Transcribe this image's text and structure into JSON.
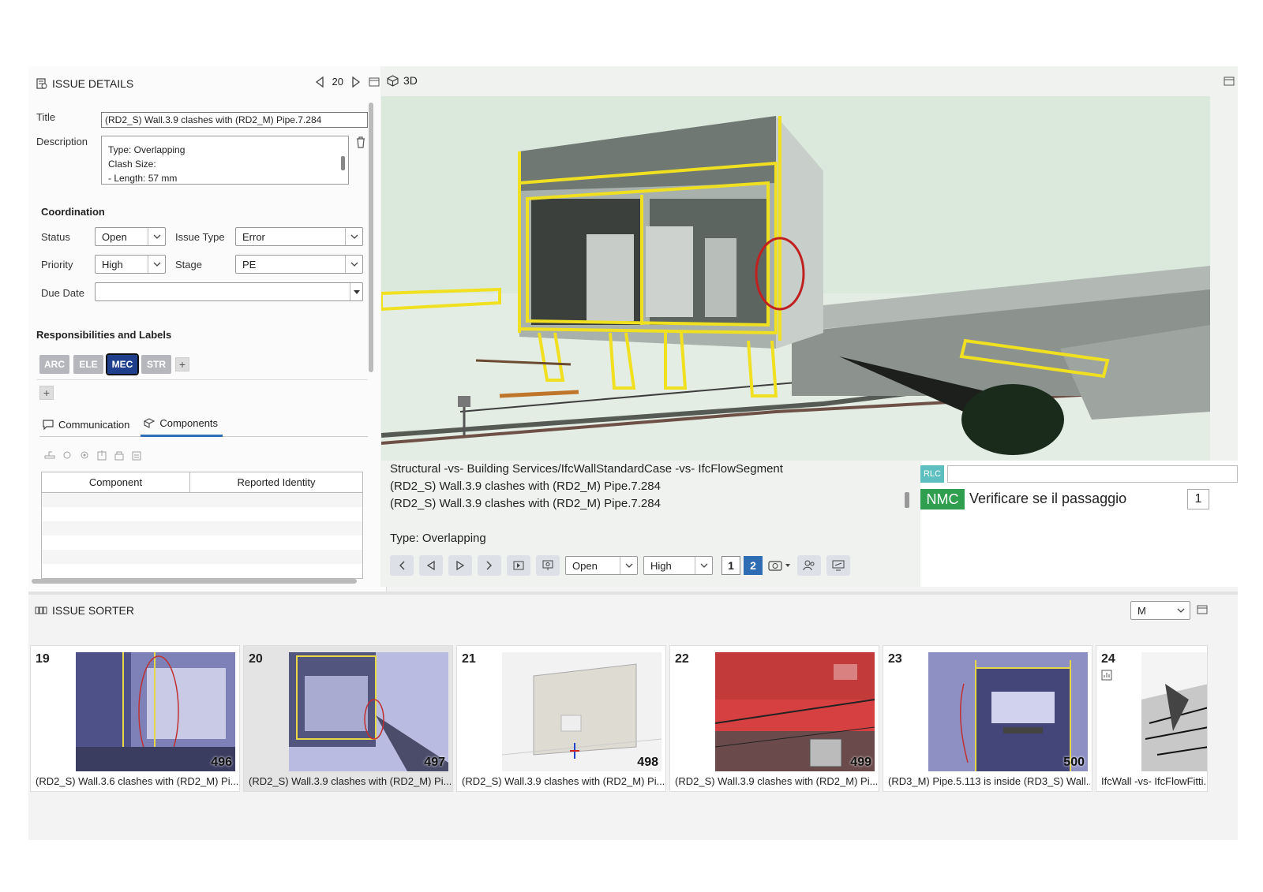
{
  "details": {
    "header": "ISSUE DETAILS",
    "issue_number": "20",
    "title_label": "Title",
    "title_value": "(RD2_S) Wall.3.9 clashes with (RD2_M) Pipe.7.284",
    "description_label": "Description",
    "description_lines": [
      "Type: Overlapping",
      "Clash Size:",
      "- Length: 57 mm"
    ],
    "coordination_header": "Coordination",
    "status_label": "Status",
    "status_value": "Open",
    "issue_type_label": "Issue Type",
    "issue_type_value": "Error",
    "priority_label": "Priority",
    "priority_value": "High",
    "stage_label": "Stage",
    "stage_value": "PE",
    "due_date_label": "Due Date",
    "due_date_value": "",
    "resp_header": "Responsibilities and Labels",
    "tags": [
      {
        "label": "ARC",
        "color": "#b5b7bd"
      },
      {
        "label": "ELE",
        "color": "#b5b7bd"
      },
      {
        "label": "MEC",
        "color": "#1f3f8c"
      },
      {
        "label": "STR",
        "color": "#b5b7bd"
      }
    ],
    "tab_communication": "Communication",
    "tab_components": "Components",
    "col_component": "Component",
    "col_reported": "Reported Identity"
  },
  "viewer": {
    "header": "3D",
    "info_lines": [
      "Structural -vs- Building Services/IfcWallStandardCase -vs- IfcFlowSegment",
      "(RD2_S) Wall.3.9 clashes with (RD2_M) Pipe.7.284",
      "(RD2_S) Wall.3.9 clashes with (RD2_M) Pipe.7.284",
      "",
      "Type: Overlapping"
    ],
    "rlc_label": "RLC",
    "nmc_label": "NMC",
    "comment_text": "Verificare se il passaggio",
    "comment_count": "1",
    "status_value": "Open",
    "priority_value": "High",
    "pages": [
      "1",
      "2"
    ]
  },
  "sorter": {
    "header": "ISSUE SORTER",
    "size_value": "M",
    "cards": [
      {
        "num": "19",
        "thumb_num": "496",
        "label": "(RD2_S) Wall.3.6 clashes with (RD2_M) Pi..."
      },
      {
        "num": "20",
        "thumb_num": "497",
        "label": "(RD2_S) Wall.3.9 clashes with (RD2_M) Pi..."
      },
      {
        "num": "21",
        "thumb_num": "498",
        "label": "(RD2_S) Wall.3.9 clashes with (RD2_M) Pi..."
      },
      {
        "num": "22",
        "thumb_num": "499",
        "label": "(RD2_S) Wall.3.9 clashes with (RD2_M) Pi..."
      },
      {
        "num": "23",
        "thumb_num": "500",
        "label": "(RD3_M) Pipe.5.113 is inside (RD3_S) Wall..."
      },
      {
        "num": "24",
        "thumb_num": "",
        "label": "IfcWall -vs- IfcFlowFitti..."
      }
    ]
  },
  "colors": {
    "accent": "#2e6db3",
    "highlight": "#f0e020",
    "nmc": "#2f9e4f",
    "rlc": "#5dbfbf"
  }
}
